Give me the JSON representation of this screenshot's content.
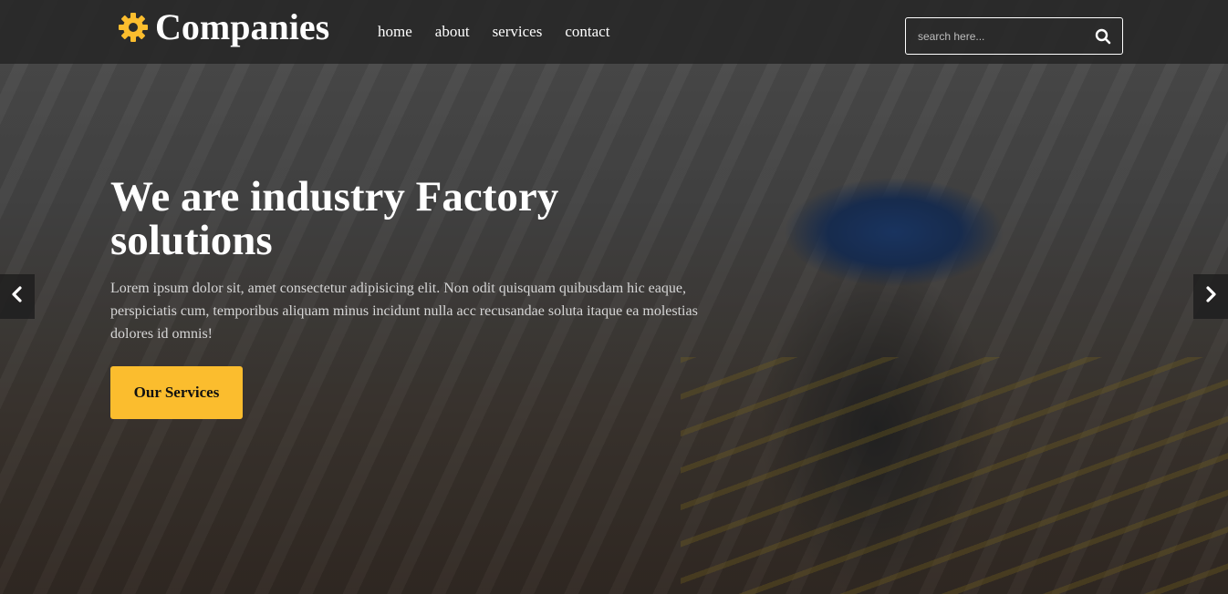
{
  "header": {
    "logo_text": "Companies",
    "logo_icon": "gear-icon",
    "nav": [
      {
        "label": "home"
      },
      {
        "label": "about"
      },
      {
        "label": "services"
      },
      {
        "label": "contact"
      }
    ],
    "search": {
      "placeholder": "search here...",
      "icon": "search-icon"
    }
  },
  "hero": {
    "title": "We are industry Factory solutions",
    "text": "Lorem ipsum dolor sit, amet consectetur adipisicing elit. Non odit quisquam quibusdam hic eaque, perspiciatis cum, temporibus aliquam minus incidunt nulla acc recusandae soluta itaque ea molestias dolores id omnis!",
    "cta_label": "Our Services",
    "prev_icon": "chevron-left-icon",
    "next_icon": "chevron-right-icon"
  },
  "colors": {
    "accent": "#fbbd2e",
    "header_bg": "#2a2a2a",
    "text_light": "#ffffff"
  }
}
